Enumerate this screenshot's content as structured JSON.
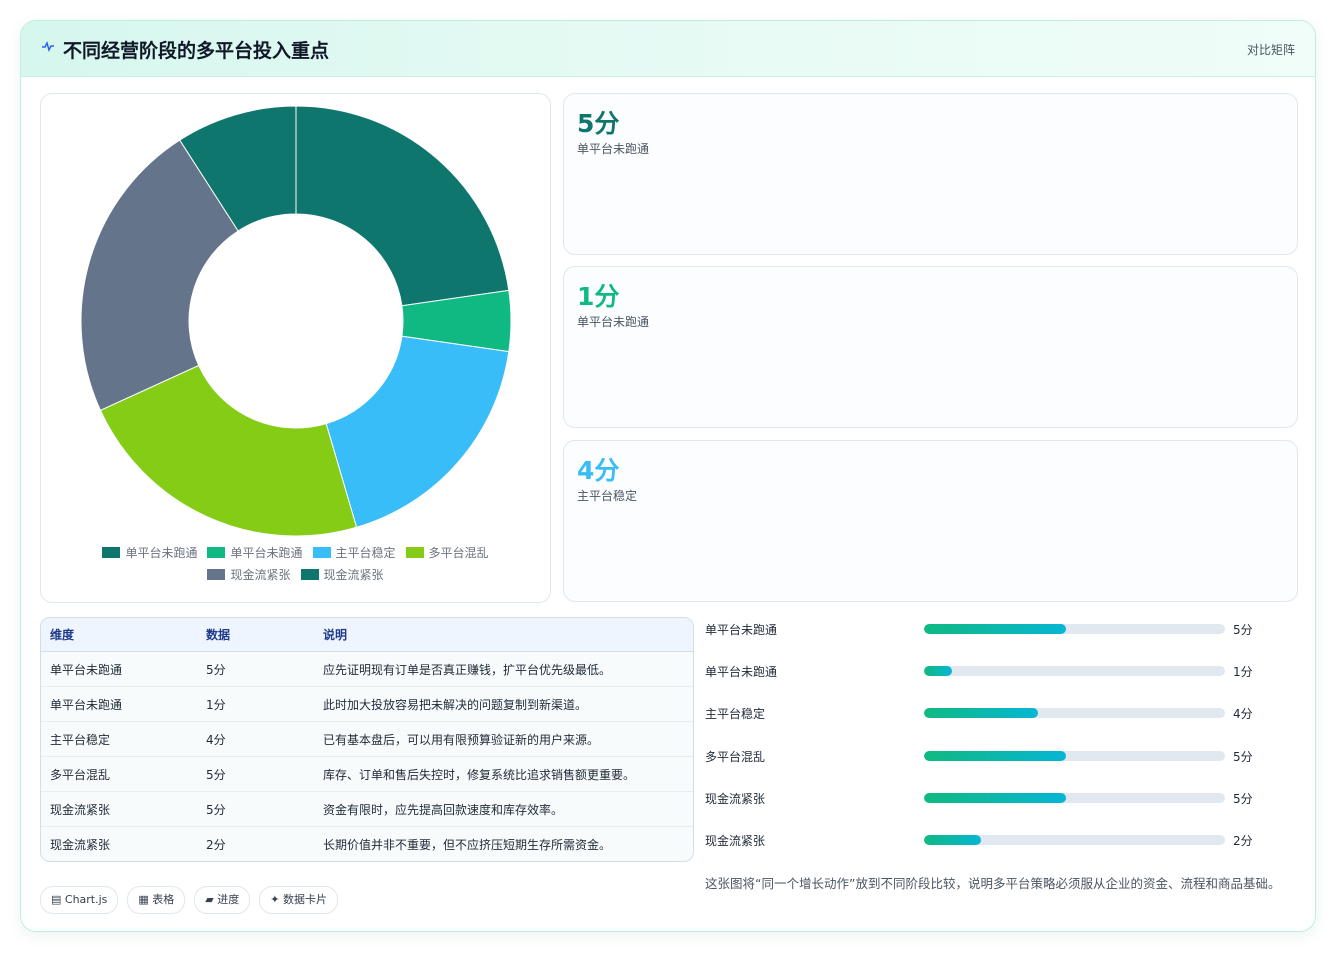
{
  "header": {
    "title": "不同经营阶段的多平台投入重点",
    "hint": "对比矩阵",
    "icon": "pulse-icon"
  },
  "kpis": [
    {
      "value": "5分",
      "label": "单平台未跑通",
      "color": "#0f766e"
    },
    {
      "value": "1分",
      "label": "单平台未跑通",
      "color": "#10b981"
    },
    {
      "value": "4分",
      "label": "主平台稳定",
      "color": "#38bdf8"
    }
  ],
  "chart_data": {
    "type": "doughnut",
    "categories": [
      "单平台未跑通",
      "单平台未跑通",
      "主平台稳定",
      "多平台混乱",
      "现金流紧张",
      "现金流紧张"
    ],
    "values": [
      5,
      1,
      4,
      5,
      5,
      2
    ],
    "colors": [
      "#0f766e",
      "#10b981",
      "#38bdf8",
      "#84cc16",
      "#64748b",
      "#0f766e"
    ],
    "legend_position": "bottom"
  },
  "table": {
    "headers": [
      "维度",
      "数据",
      "说明"
    ],
    "rows": [
      [
        "单平台未跑通",
        "5分",
        "应先证明现有订单是否真正赚钱，扩平台优先级最低。"
      ],
      [
        "单平台未跑通",
        "1分",
        "此时加大投放容易把未解决的问题复制到新渠道。"
      ],
      [
        "主平台稳定",
        "4分",
        "已有基本盘后，可以用有限预算验证新的用户来源。"
      ],
      [
        "多平台混乱",
        "5分",
        "库存、订单和售后失控时，修复系统比追求销售额更重要。"
      ],
      [
        "现金流紧张",
        "5分",
        "资金有限时，应先提高回款速度和库存效率。"
      ],
      [
        "现金流紧张",
        "2分",
        "长期价值并非不重要，但不应挤压短期生存所需资金。"
      ]
    ]
  },
  "bars": [
    {
      "label": "单平台未跑通",
      "value": 5,
      "text": "5分"
    },
    {
      "label": "单平台未跑通",
      "value": 1,
      "text": "1分"
    },
    {
      "label": "主平台稳定",
      "value": 4,
      "text": "4分"
    },
    {
      "label": "多平台混乱",
      "value": 5,
      "text": "5分"
    },
    {
      "label": "现金流紧张",
      "value": 5,
      "text": "5分"
    },
    {
      "label": "现金流紧张",
      "value": 2,
      "text": "2分"
    }
  ],
  "bar_max": 10.6,
  "note": "这张图将“同一个增长动作”放到不同阶段比较，说明多平台策略必须服从企业的资金、流程和商品基础。",
  "tags": [
    "▤ Chart.js",
    "▦ 表格",
    "▰ 进度",
    "✦ 数据卡片"
  ]
}
